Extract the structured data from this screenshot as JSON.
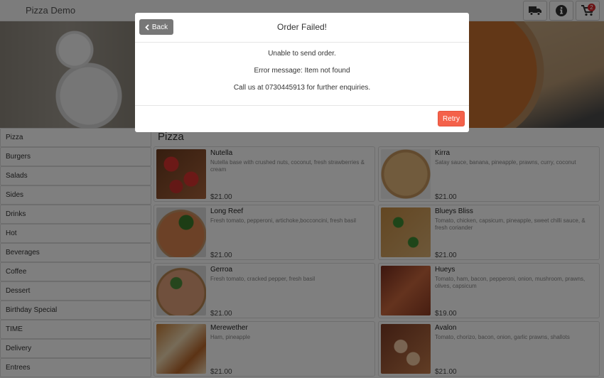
{
  "header": {
    "brand": "Pizza Demo",
    "buttons": [
      {
        "name": "delivery-truck-icon"
      },
      {
        "name": "info-icon"
      },
      {
        "name": "cart-icon",
        "badge": "2"
      }
    ]
  },
  "sidebar": {
    "items": [
      {
        "label": "Pizza"
      },
      {
        "label": "Burgers"
      },
      {
        "label": "Salads"
      },
      {
        "label": "Sides"
      },
      {
        "label": "Drinks"
      },
      {
        "label": "Hot"
      },
      {
        "label": "Beverages"
      },
      {
        "label": "Coffee"
      },
      {
        "label": "Dessert"
      },
      {
        "label": "Birthday Special"
      },
      {
        "label": "TIME"
      },
      {
        "label": "Delivery"
      },
      {
        "label": "Entrees"
      }
    ]
  },
  "main": {
    "section_title": "Pizza",
    "items": [
      {
        "name": "Nutella",
        "description": "Nutella base with crushed nuts, coconut, fresh strawberries & cream",
        "price": "$21.00"
      },
      {
        "name": "Kirra",
        "description": "Satay sauce, banana, pineapple, prawns, curry, coconut",
        "price": "$21.00"
      },
      {
        "name": "Long Reef",
        "description": "Fresh tomato, pepperoni, artichoke,bocconcini, fresh basil",
        "price": "$21.00"
      },
      {
        "name": "Blueys Bliss",
        "description": "Tomato, chicken, capsicum, pineapple, sweet chilli sauce, & fresh coriander",
        "price": "$21.00"
      },
      {
        "name": "Gerroa",
        "description": "Fresh tomato, cracked pepper, fresh basil",
        "price": "$21.00"
      },
      {
        "name": "Hueys",
        "description": "Tomato, ham, bacon, pepperoni, onion, mushroom, prawns, olives, capsicum",
        "price": "$19.00"
      },
      {
        "name": "Merewether",
        "description": "Ham, pineapple",
        "price": "$21.00"
      },
      {
        "name": "Avalon",
        "description": "Tomato, chorizo, bacon, onion, garlic prawns, shallots",
        "price": "$21.00"
      }
    ]
  },
  "modal": {
    "back_label": "Back",
    "title": "Order Failed!",
    "messages": [
      "Unable to send order.",
      "Error message: Item not found",
      "Call us at 0730445913 for further enquiries."
    ],
    "retry_label": "Retry"
  },
  "colors": {
    "retry": "#f4614a",
    "back": "#777777",
    "badge": "#d9262b"
  }
}
